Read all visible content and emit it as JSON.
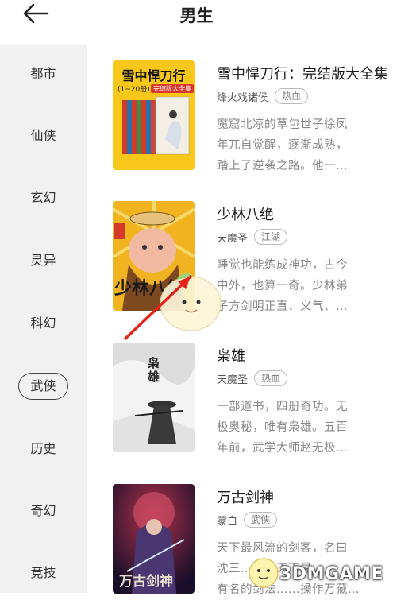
{
  "header": {
    "title": "男生"
  },
  "sidebar": {
    "categories": [
      {
        "label": "都市"
      },
      {
        "label": "仙侠"
      },
      {
        "label": "玄幻"
      },
      {
        "label": "灵异"
      },
      {
        "label": "科幻"
      },
      {
        "label": "武侠"
      },
      {
        "label": "历史"
      },
      {
        "label": "奇幻"
      },
      {
        "label": "竞技"
      }
    ],
    "active_index": 5
  },
  "books": [
    {
      "title": "雪中悍刀行：完结版大全集",
      "author": "烽火戏诸侯",
      "tag": "热血",
      "desc": [
        "魔窟北凉的草包世子徐凤",
        "年兀自觉醒，逐渐成熟，",
        "踏上了逆袭之路。他一…"
      ],
      "cover": {
        "title": "雪中悍刀行",
        "subtitle": "(1~20册)",
        "badge": "完结版大全集"
      }
    },
    {
      "title": "少林八绝",
      "author": "天魔圣",
      "tag": "江湖",
      "desc": [
        "睡觉也能练成神功，古今",
        "中外，也算一奇。少林弟",
        "子方剑明正直、义气、…"
      ],
      "cover": {
        "title": "少林八绝"
      }
    },
    {
      "title": "枭雄",
      "author": "天魔圣",
      "tag": "热血",
      "desc": [
        "一部道书，四册奇功。无",
        "极奥秘，唯有枭雄。五百",
        "年前，武学大师赵无极…"
      ],
      "cover": {
        "title": "枭雄"
      }
    },
    {
      "title": "万古剑神",
      "author": "蒙白",
      "tag": "武侠",
      "desc": [
        "天下最风流的剑客，名曰",
        "沈三………天下最",
        "有名的剑法……操作万藏…"
      ],
      "cover": {
        "title": "万古剑神"
      }
    }
  ],
  "watermark": {
    "text": "3DMGAME"
  }
}
